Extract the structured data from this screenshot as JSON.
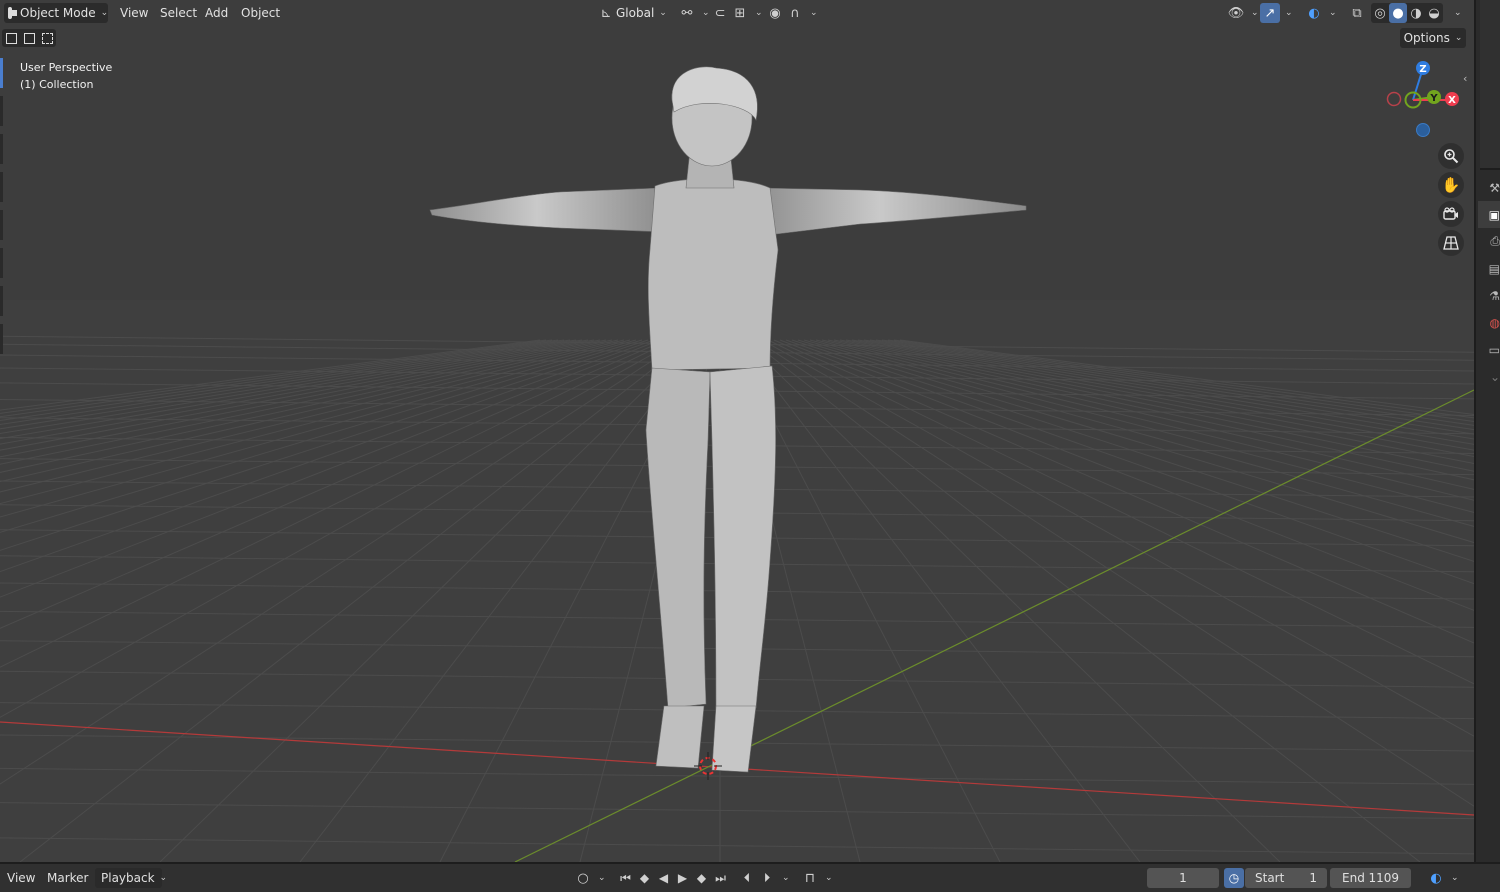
{
  "header": {
    "mode": "Object Mode",
    "menus": [
      "View",
      "Select",
      "Add",
      "Object"
    ],
    "transform_orientation": "Global",
    "options_label": "Options"
  },
  "viewport": {
    "view_name": "User Perspective",
    "collection": "(1) Collection"
  },
  "gizmo": {
    "z_label": "Z",
    "y_label": "Y",
    "x_label": "X",
    "colors": {
      "x": "#ee3d4f",
      "y": "#72a51e",
      "z": "#2f7de1"
    }
  },
  "nav_icons": [
    "zoom-icon",
    "pan-hand-icon",
    "camera-icon",
    "grid-ortho-icon"
  ],
  "timeline": {
    "menus": [
      "View",
      "Marker",
      "Playback"
    ],
    "current_frame": "1",
    "start_label": "Start",
    "start_value": "1",
    "end_label": "End",
    "end_value": "1109"
  },
  "properties_tabs": [
    "tool-icon",
    "render-icon",
    "output-icon",
    "view-layer-icon",
    "scene-icon",
    "world-icon",
    "collection-icon"
  ]
}
